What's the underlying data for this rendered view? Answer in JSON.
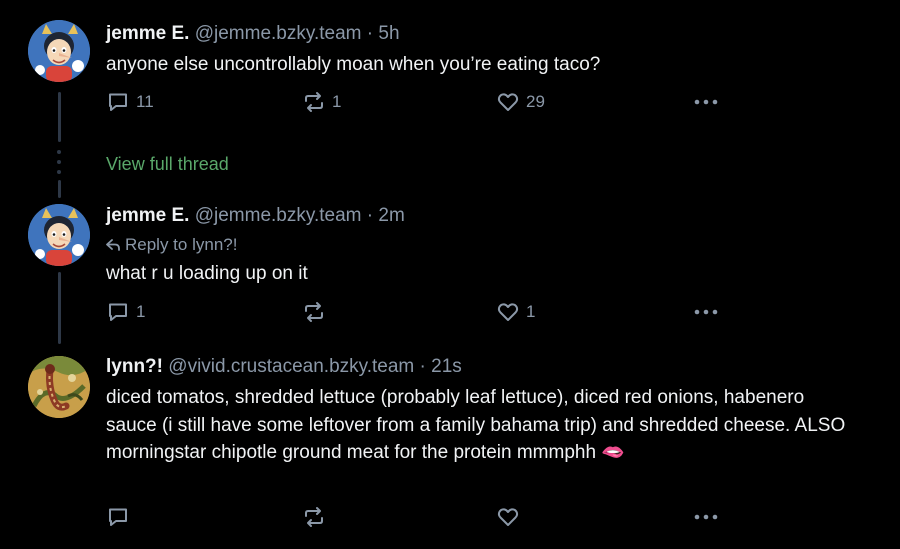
{
  "colors": {
    "background": "#000000",
    "text_primary": "#f1f3f5",
    "text_secondary": "#8b98a8",
    "link_green": "#5aa86a",
    "thread_line": "#2e3847"
  },
  "posts": [
    {
      "name": "jemme E.",
      "handle": "@jemme.bzky.team",
      "separator": "·",
      "time": "5h",
      "text": "anyone else uncontrollably moan when  you’re eating taco?",
      "replies": "11",
      "reposts": "1",
      "likes": "29",
      "avatar_icon": "cartoon-avatar"
    },
    {
      "name": "jemme E.",
      "handle": "@jemme.bzky.team",
      "separator": "·",
      "time": "2m",
      "reply_to": "Reply to lynn?!",
      "text": "what r u loading up on it",
      "replies": "1",
      "reposts": "",
      "likes": "1",
      "avatar_icon": "cartoon-avatar"
    },
    {
      "name": "lynn?!",
      "handle": "@vivid.crustacean.bzky.team",
      "separator": "·",
      "time": "21s",
      "text": "diced tomatos, shredded lettuce (probably leaf lettuce), diced red onions, habenero sauce (i still have some leftover from a family bahama trip) and shredded cheese. ALSO morningstar chipotle ground meat for the protein mmmphh 🫦",
      "replies": "",
      "reposts": "",
      "likes": "",
      "avatar_icon": "illustration-avatar"
    }
  ],
  "thread": {
    "view_full_thread": "View full thread"
  }
}
